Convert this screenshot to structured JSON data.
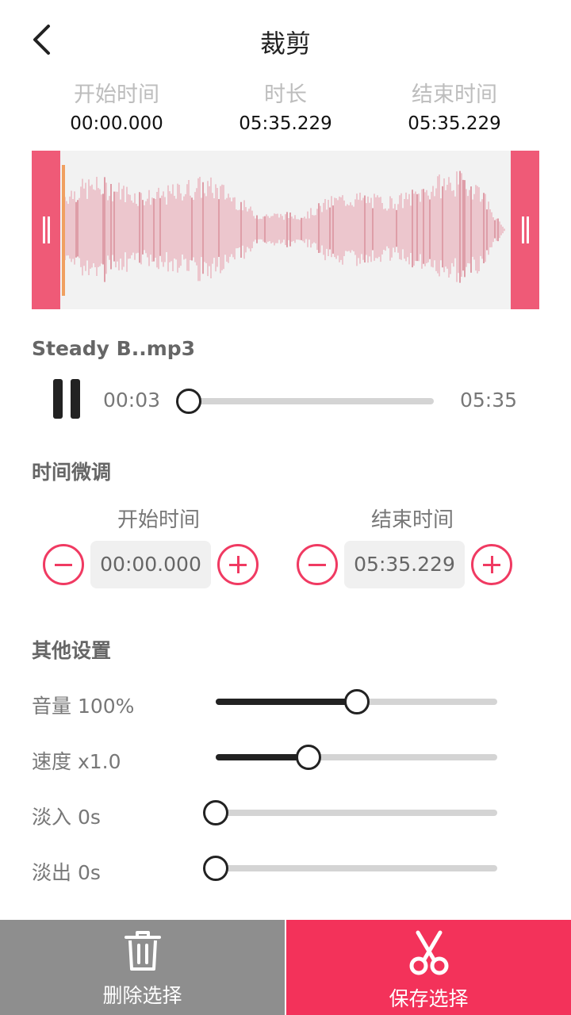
{
  "header": {
    "title": "裁剪",
    "back_icon": "back-arrow-icon"
  },
  "times": {
    "start_label": "开始时间",
    "start_value": "00:00.000",
    "duration_label": "时长",
    "duration_value": "05:35.229",
    "end_label": "结束时间",
    "end_value": "05:35.229"
  },
  "player": {
    "file_name": "Steady B..mp3",
    "current_time": "00:03",
    "total_time": "05:35",
    "progress_fraction": 0.01,
    "pause_icon": "pause-icon"
  },
  "fine_tune": {
    "title": "时间微调",
    "start_label": "开始时间",
    "start_value": "00:00.000",
    "end_label": "结束时间",
    "end_value": "05:35.229",
    "minus_icon": "minus-circle-icon",
    "plus_icon": "plus-circle-icon"
  },
  "settings": {
    "title": "其他设置",
    "volume_label": "音量 100%",
    "volume_fraction": 0.5,
    "speed_label": "速度 x1.0",
    "speed_fraction": 0.33,
    "fade_in_label": "淡入 0s",
    "fade_in_fraction": 0,
    "fade_out_label": "淡出 0s",
    "fade_out_fraction": 0
  },
  "bottom": {
    "delete_label": "删除选择",
    "delete_icon": "trash-icon",
    "save_label": "保存选择",
    "save_icon": "scissors-icon"
  },
  "colors": {
    "accent": "#f3325a",
    "handle": "#ef5a77",
    "wave": "#e59aa8",
    "delete_bg": "#8e8e8e"
  }
}
